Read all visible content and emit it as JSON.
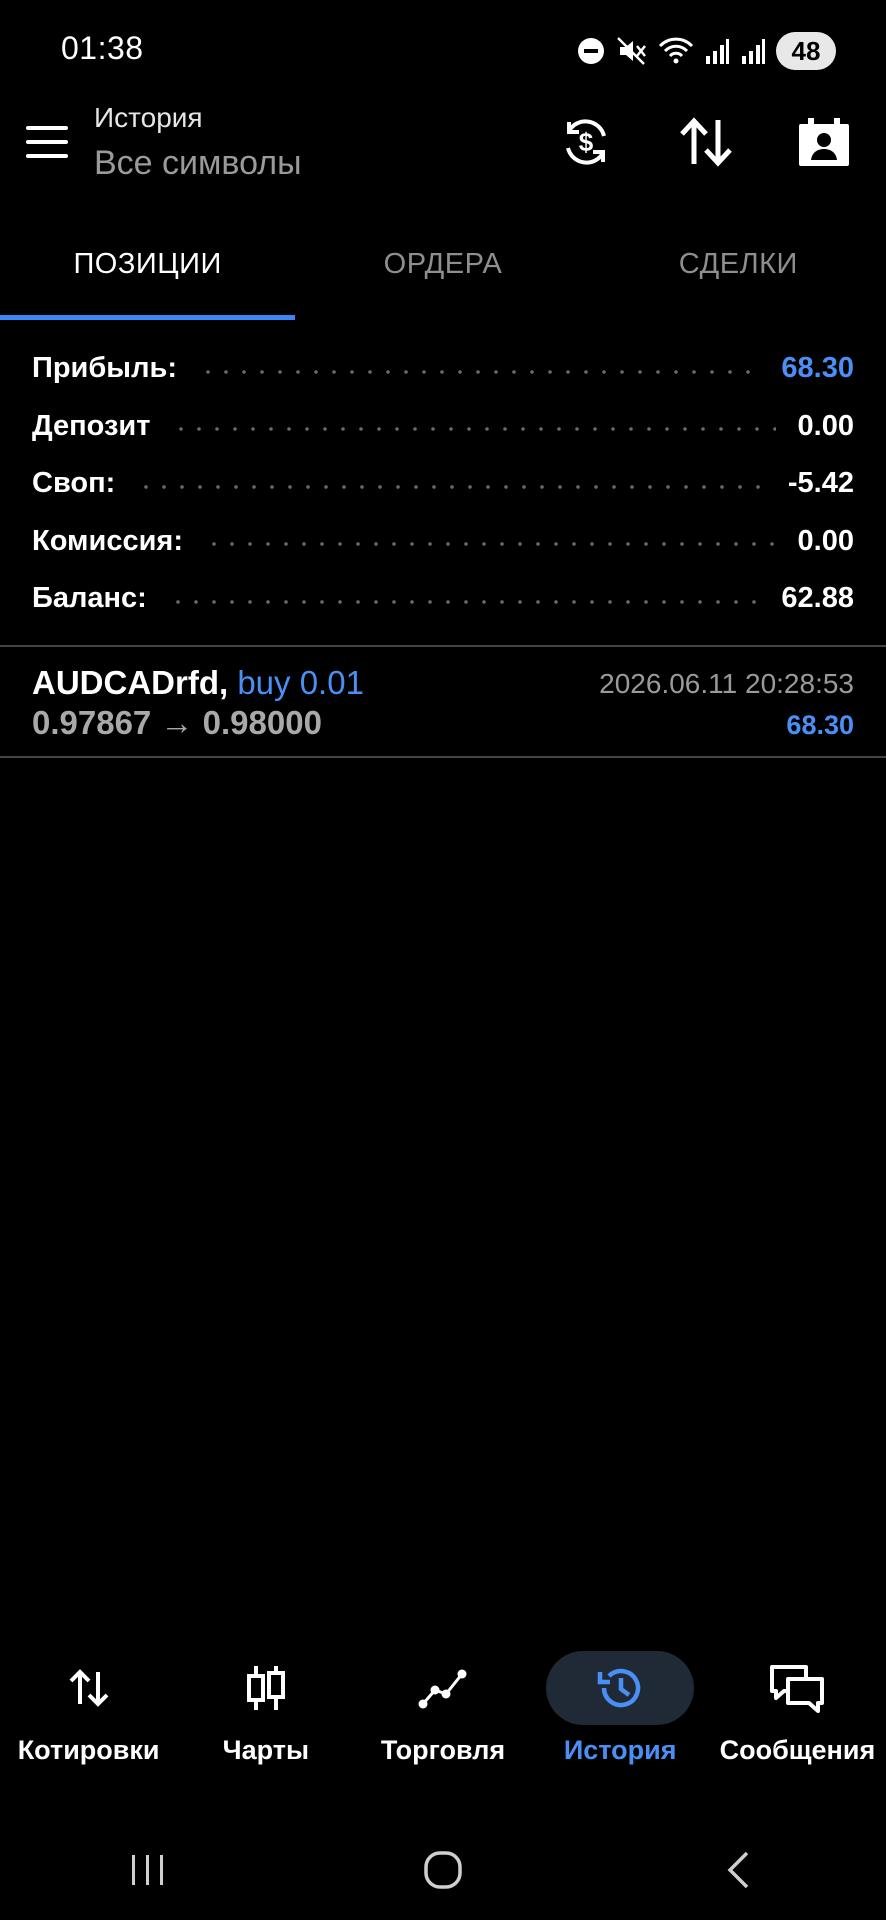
{
  "status_bar": {
    "time": "01:38",
    "battery": "48",
    "icons": [
      "dnd-icon",
      "mute-icon",
      "wifi-icon",
      "signal-icon",
      "signal-icon"
    ]
  },
  "app_bar": {
    "title": "История",
    "subtitle": "Все символы",
    "actions": [
      "currency-exchange-icon",
      "sort-icon",
      "account-icon"
    ]
  },
  "tabs": [
    {
      "label": "ПОЗИЦИИ",
      "active": true
    },
    {
      "label": "ОРДЕРА",
      "active": false
    },
    {
      "label": "СДЕЛКИ",
      "active": false
    }
  ],
  "summary": {
    "profit": {
      "label": "Прибыль:",
      "value": "68.30"
    },
    "deposit": {
      "label": "Депозит",
      "value": "0.00"
    },
    "swap": {
      "label": "Своп:",
      "value": "-5.42"
    },
    "commission": {
      "label": "Комиссия:",
      "value": "0.00"
    },
    "balance": {
      "label": "Баланс:",
      "value": "62.88"
    }
  },
  "positions": [
    {
      "symbol": "AUDCADrfd,",
      "type": "buy 0.01",
      "open_price": "0.97867",
      "arrow": "→",
      "close_price": "0.98000",
      "time": "2026.06.11 20:28:53",
      "profit": "68.30"
    }
  ],
  "bottom_nav": [
    {
      "label": "Котировки",
      "icon": "quotes-icon",
      "active": false
    },
    {
      "label": "Чарты",
      "icon": "charts-icon",
      "active": false
    },
    {
      "label": "Торговля",
      "icon": "trade-icon",
      "active": false
    },
    {
      "label": "История",
      "icon": "history-icon",
      "active": true
    },
    {
      "label": "Сообщения",
      "icon": "messages-icon",
      "active": false
    }
  ],
  "colors": {
    "accent": "#4a8ff5",
    "tab_indicator": "#3d86f3",
    "background": "#000000"
  }
}
